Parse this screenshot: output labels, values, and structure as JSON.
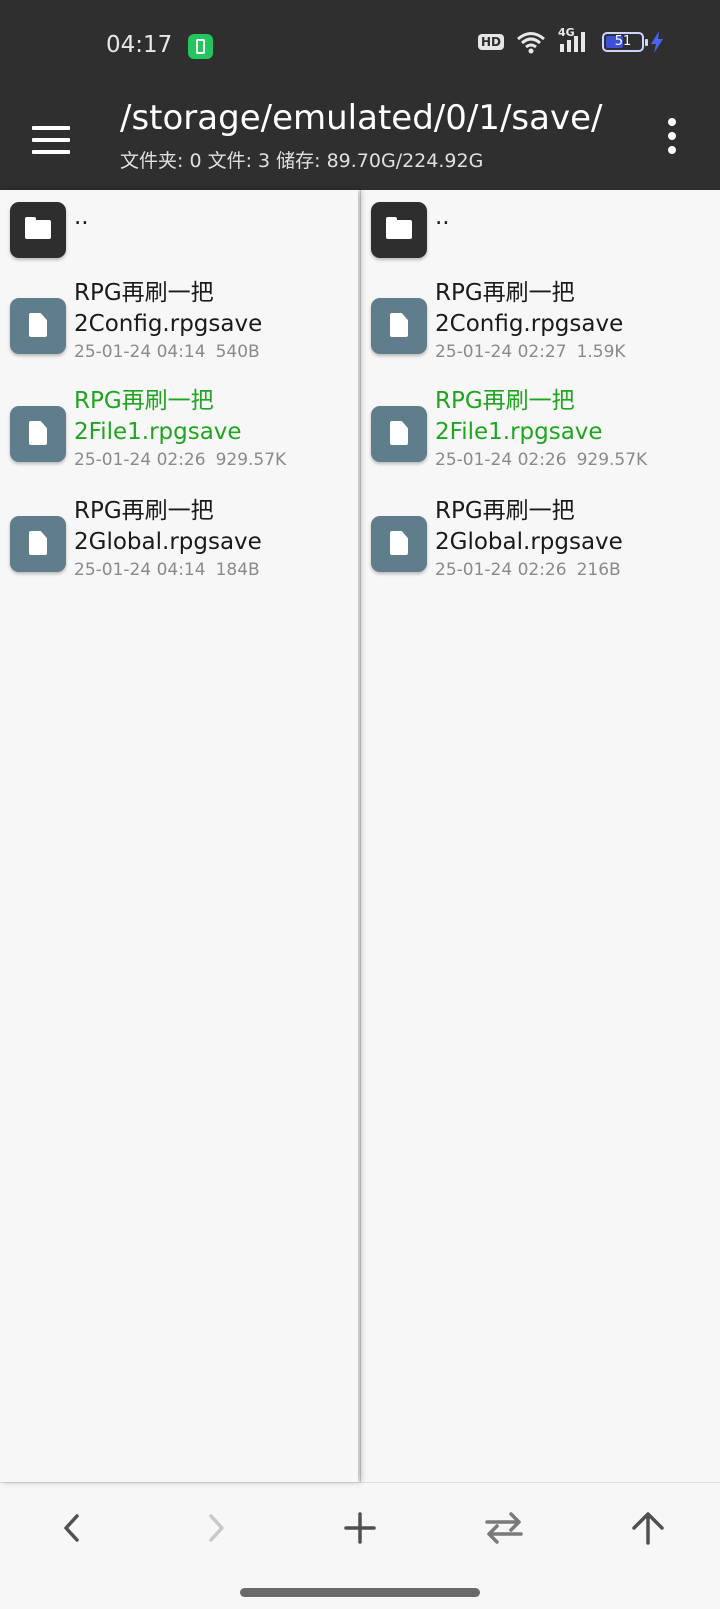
{
  "status_bar": {
    "time": "04:17",
    "hd_label": "HD",
    "network_label": "4G",
    "battery_level": "51",
    "battery_percent": 51
  },
  "toolbar": {
    "path": "/storage/emulated/0/1/save/",
    "info": "文件夹: 0  文件: 3  储存: 89.70G/224.92G"
  },
  "left_pane": {
    "parent_label": "..",
    "files": [
      {
        "name_line1": "RPG再刷一把",
        "name_line2": "2Config.rpgsave",
        "date": "25-01-24 04:14",
        "size": "540B",
        "highlight": false
      },
      {
        "name_line1": "RPG再刷一把",
        "name_line2": "2File1.rpgsave",
        "date": "25-01-24 02:26",
        "size": "929.57K",
        "highlight": true
      },
      {
        "name_line1": "RPG再刷一把",
        "name_line2": "2Global.rpgsave",
        "date": "25-01-24 04:14",
        "size": "184B",
        "highlight": false
      }
    ]
  },
  "right_pane": {
    "parent_label": "..",
    "files": [
      {
        "name_line1": "RPG再刷一把",
        "name_line2": "2Config.rpgsave",
        "date": "25-01-24 02:27",
        "size": "1.59K",
        "highlight": false
      },
      {
        "name_line1": "RPG再刷一把",
        "name_line2": "2File1.rpgsave",
        "date": "25-01-24 02:26",
        "size": "929.57K",
        "highlight": true
      },
      {
        "name_line1": "RPG再刷一把",
        "name_line2": "2Global.rpgsave",
        "date": "25-01-24 02:26",
        "size": "216B",
        "highlight": false
      }
    ]
  },
  "colors": {
    "header_bg": "#2f2f2f",
    "highlight_green": "#1fa51f",
    "file_icon_bg": "#607d8b",
    "folder_icon_bg": "#2e2e2e"
  },
  "bottom_bar": {
    "back_icon": "chevron-left-icon",
    "forward_icon": "chevron-right-icon",
    "add_icon": "plus-icon",
    "swap_icon": "swap-icon",
    "up_icon": "arrow-up-icon"
  }
}
